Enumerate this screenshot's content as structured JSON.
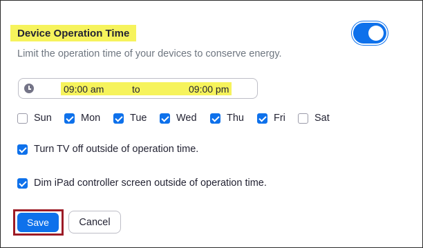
{
  "section": {
    "title": "Device Operation Time",
    "description": "Limit the operation time of your devices to conserve energy.",
    "enabled": true
  },
  "time_range": {
    "icon": "clock-icon",
    "start": "09:00 am",
    "separator": "to",
    "end": "09:00 pm"
  },
  "days": [
    {
      "label": "Sun",
      "checked": false
    },
    {
      "label": "Mon",
      "checked": true
    },
    {
      "label": "Tue",
      "checked": true
    },
    {
      "label": "Wed",
      "checked": true
    },
    {
      "label": "Thu",
      "checked": true
    },
    {
      "label": "Fri",
      "checked": true
    },
    {
      "label": "Sat",
      "checked": false
    }
  ],
  "options": [
    {
      "label": "Turn TV off outside of operation time.",
      "checked": true
    },
    {
      "label": "Dim iPad controller screen outside of operation time.",
      "checked": true
    }
  ],
  "actions": {
    "save_label": "Save",
    "cancel_label": "Cancel"
  },
  "colors": {
    "accent": "#0e71eb",
    "highlight": "#f6f35c",
    "save_outline": "#9c1b26"
  }
}
